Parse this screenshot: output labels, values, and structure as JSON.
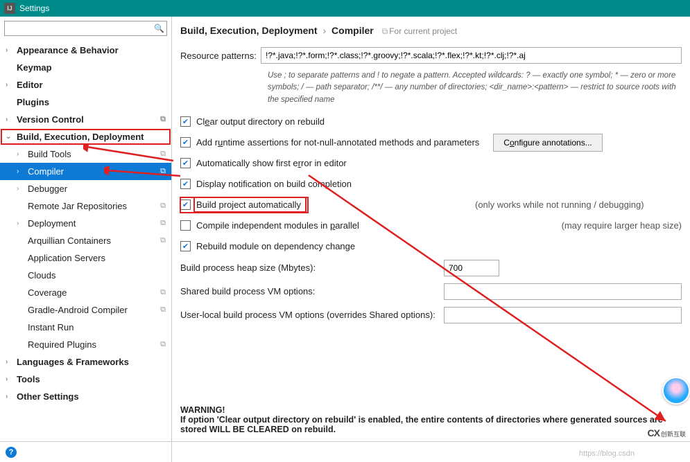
{
  "window": {
    "title": "Settings"
  },
  "search": {
    "placeholder": ""
  },
  "tree": {
    "appearance": "Appearance & Behavior",
    "keymap": "Keymap",
    "editor": "Editor",
    "plugins": "Plugins",
    "version_control": "Version Control",
    "bed": "Build, Execution, Deployment",
    "build_tools": "Build Tools",
    "compiler": "Compiler",
    "debugger": "Debugger",
    "remote_jar": "Remote Jar Repositories",
    "deployment": "Deployment",
    "arquillian": "Arquillian Containers",
    "app_servers": "Application Servers",
    "clouds": "Clouds",
    "coverage": "Coverage",
    "gradle_android": "Gradle-Android Compiler",
    "instant_run": "Instant Run",
    "required_plugins": "Required Plugins",
    "languages": "Languages & Frameworks",
    "tools": "Tools",
    "other": "Other Settings"
  },
  "breadcrumb": {
    "parent": "Build, Execution, Deployment",
    "current": "Compiler",
    "scope": "For current project"
  },
  "main": {
    "resource_patterns_label": "Resource patterns:",
    "resource_patterns_value": "!?*.java;!?*.form;!?*.class;!?*.groovy;!?*.scala;!?*.flex;!?*.kt;!?*.clj;!?*.aj",
    "hint": "Use ; to separate patterns and ! to negate a pattern. Accepted wildcards: ? — exactly one symbol; * — zero or more symbols; / — path separator; /**/ — any number of directories; <dir_name>:<pattern> — restrict to source roots with the specified name",
    "chk_clear": "Clear output directory on rebuild",
    "chk_runtime": "Add runtime assertions for not-null-annotated methods and parameters",
    "btn_configure": "Configure annotations...",
    "chk_first_error": "Automatically show first error in editor",
    "chk_notification": "Display notification on build completion",
    "chk_auto_build": "Build project automatically",
    "auto_build_note": "(only works while not running / debugging)",
    "chk_parallel": "Compile independent modules in parallel",
    "parallel_note": "(may require larger heap size)",
    "chk_rebuild_dep": "Rebuild module on dependency change",
    "heap_label": "Build process heap size (Mbytes):",
    "heap_value": "700",
    "shared_vm_label": "Shared build process VM options:",
    "shared_vm_value": "",
    "user_vm_label": "User-local build process VM options (overrides Shared options):",
    "user_vm_value": "",
    "warning_title": "WARNING!",
    "warning_body": "If option 'Clear output directory on rebuild' is enabled, the entire contents of directories where generated sources are stored WILL BE CLEARED on rebuild."
  },
  "watermark": "https://blog.csdn",
  "cx_logo": "创新互联"
}
